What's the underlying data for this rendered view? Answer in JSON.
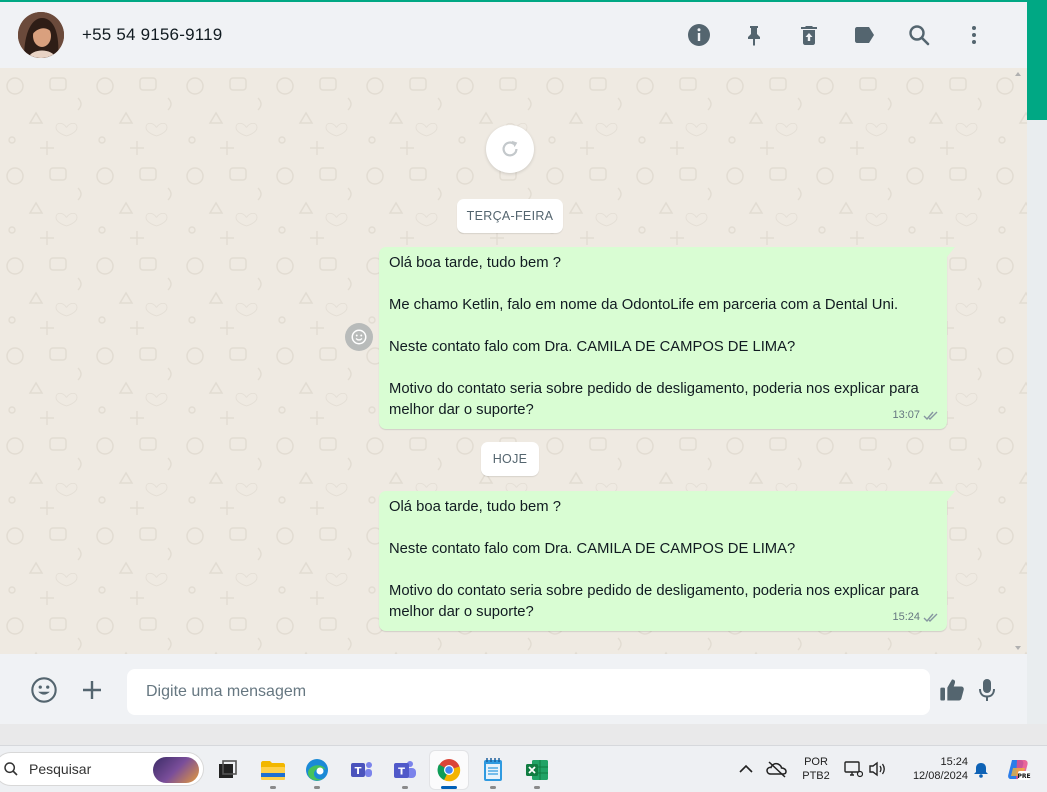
{
  "header": {
    "contact_name": "+55 54 9156-9119",
    "icons": [
      "info-icon",
      "pin-icon",
      "delete-icon",
      "label-icon",
      "search-icon",
      "more-icon"
    ]
  },
  "chat": {
    "date_chips": [
      "TERÇA-FEIRA",
      "HOJE"
    ],
    "messages": [
      {
        "text": "Olá boa tarde, tudo bem ?\n\nMe chamo Ketlin, falo em nome da OdontoLife em parceria com a Dental Uni.\n\nNeste contato falo com Dra. CAMILA DE CAMPOS DE LIMA?\n\nMotivo do contato seria sobre pedido de desligamento, poderia nos explicar para melhor dar o suporte?",
        "time": "13:07",
        "status": "read-double-check"
      },
      {
        "text": "Olá boa tarde, tudo bem ?\n\nNeste contato falo com Dra. CAMILA DE CAMPOS DE LIMA?\n\nMotivo do contato seria sobre pedido de desligamento, poderia nos explicar para melhor dar o suporte?",
        "time": "15:24",
        "status": "read-double-check"
      }
    ]
  },
  "composer": {
    "placeholder": "Digite uma mensagem"
  },
  "taskbar": {
    "search_label": "Pesquisar",
    "lang": "POR",
    "layout": "PTB2",
    "time": "15:24",
    "date": "12/08/2024"
  },
  "colors": {
    "accent": "#00a884",
    "bubble_out": "#d9fdd3",
    "chat_bg": "#efeae2",
    "header_bg": "#f0f2f5"
  }
}
